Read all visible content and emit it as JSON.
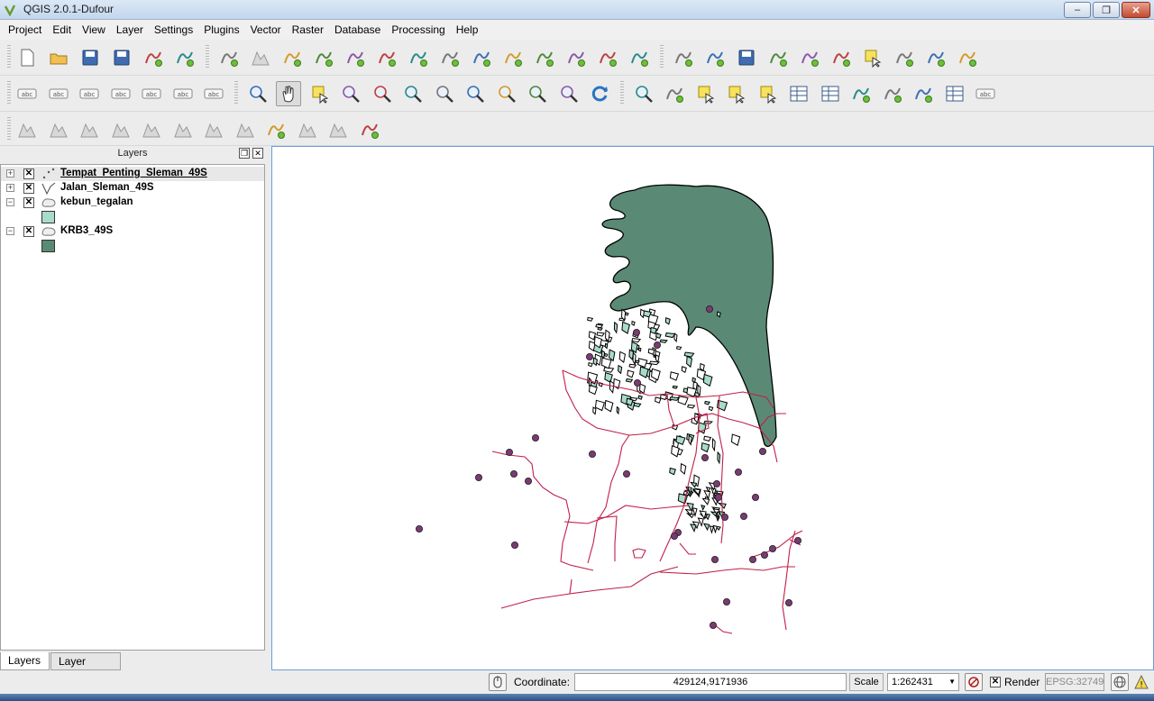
{
  "window": {
    "title": "QGIS 2.0.1-Dufour",
    "minimize": "‒",
    "maximize": "❐",
    "close": "✕"
  },
  "menu": [
    "Project",
    "Edit",
    "View",
    "Layer",
    "Settings",
    "Plugins",
    "Vector",
    "Raster",
    "Database",
    "Processing",
    "Help"
  ],
  "toolbar_icons": {
    "row1": [
      "new-project",
      "open-project",
      "save-project",
      "save-project-as",
      "new-print-composer",
      "composer-manager",
      "add-vector-layer",
      "add-raster-layer",
      "add-postgis-layer",
      "add-spatialite-layer",
      "add-mssql-layer",
      "add-oracle-layer",
      "add-sqlanywhere-layer",
      "add-wms-layer",
      "add-wcs-layer",
      "add-wfs-layer",
      "add-delimited-text-layer",
      "new-shapefile-layer",
      "new-spatialite-layer",
      "remove-layer",
      "toggle-editing",
      "current-edits",
      "save-edits",
      "add-feature",
      "move-feature",
      "node-tool",
      "delete-selected",
      "cut-features",
      "copy-features",
      "paste-features"
    ],
    "row2": [
      "label-tool",
      "pin-labels",
      "show-hide-labels",
      "move-label",
      "rotate-label",
      "change-label",
      "label-settings",
      "touch-zoom",
      "pan-map",
      "pan-to-selection",
      "zoom-in",
      "zoom-out",
      "zoom-native",
      "zoom-full",
      "zoom-to-selection",
      "zoom-to-layer",
      "zoom-last",
      "zoom-next",
      "refresh",
      "identify-features",
      "run-feature-action",
      "select-features",
      "deselect-features",
      "expression-select",
      "open-attribute-table",
      "field-calculator",
      "measure-line",
      "map-tips",
      "new-bookmark",
      "show-bookmarks",
      "text-annotation"
    ],
    "row3": [
      "raster-histogram-stretch",
      "raster-local-stretch",
      "raster-full-stretch",
      "raster-cumulative-stretch",
      "increase-brightness",
      "decrease-brightness",
      "increase-contrast",
      "decrease-contrast",
      "coordinate-capture",
      "lighting",
      "raster-terrain",
      "zonal-statistics"
    ]
  },
  "layers_panel": {
    "title": "Layers",
    "layers": [
      {
        "name": "Tempat_Penting_Sleman_49S",
        "geometry": "point",
        "checked": "✕",
        "expander": "+",
        "active": true,
        "symbol_color": ""
      },
      {
        "name": "Jalan_Sleman_49S",
        "geometry": "line",
        "checked": "✕",
        "expander": "+",
        "active": false,
        "symbol_color": ""
      },
      {
        "name": "kebun_tegalan",
        "geometry": "polygon",
        "checked": "✕",
        "expander": "−",
        "active": false,
        "symbol_color": "#a9dcc8"
      },
      {
        "name": "KRB3_49S",
        "geometry": "polygon",
        "checked": "✕",
        "expander": "−",
        "active": false,
        "symbol_color": "#5a8a76"
      }
    ],
    "tabs": [
      "Layers",
      "Layer order"
    ]
  },
  "map": {
    "colors": {
      "krb3_fill": "#5a8a76",
      "kebun_fill": "#a9dcc8",
      "road": "#c0204a",
      "point_fill": "#7a3a72",
      "outline": "#000000"
    }
  },
  "status": {
    "coordinate_label": "Coordinate:",
    "coordinate_value": "429124,9171936",
    "scale_label": "Scale",
    "scale_value": "1:262431",
    "render_label": "Render",
    "render_checked": "✕",
    "crs": "EPSG:32749"
  }
}
